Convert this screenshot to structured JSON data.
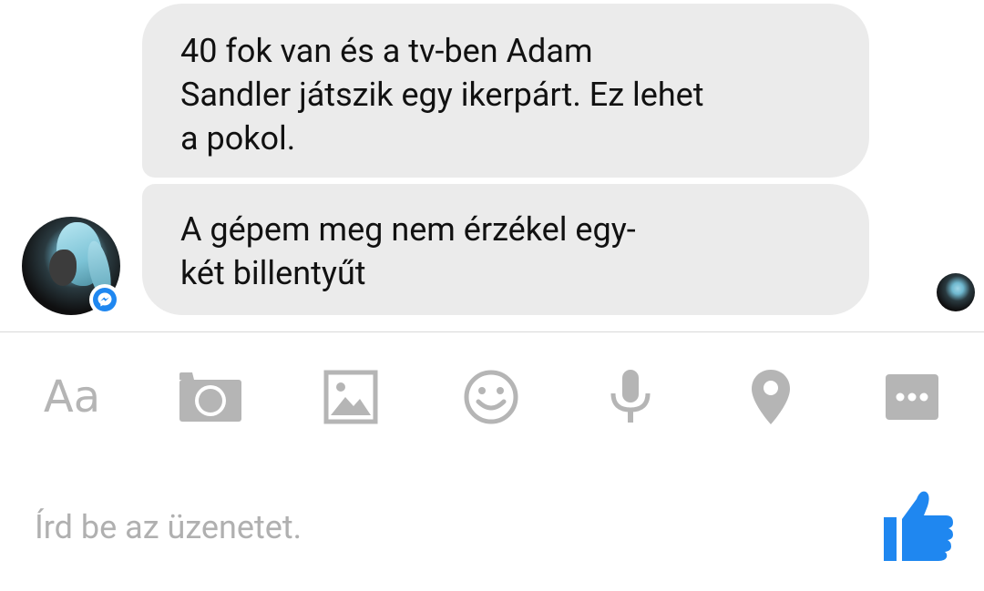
{
  "messages": [
    {
      "text": "40 fok van és a tv-ben Adam\nSandler játszik egy ikerpárt. Ez lehet\na pokol."
    },
    {
      "text": "A gépem meg nem érzékel egy-\nkét billentyűt"
    }
  ],
  "composer": {
    "text_tool_label": "Aa",
    "placeholder": "Írd be az üzenetet."
  },
  "icons": {
    "toolbar": [
      "text-icon",
      "camera-icon",
      "image-icon",
      "emoji-icon",
      "microphone-icon",
      "location-pin-icon",
      "more-icon"
    ],
    "send": "thumbs-up-icon",
    "badge": "messenger-icon"
  },
  "colors": {
    "bubble_bg": "#ebebeb",
    "icon_gray": "#b5b5b5",
    "accent_blue": "#1f87f0"
  }
}
